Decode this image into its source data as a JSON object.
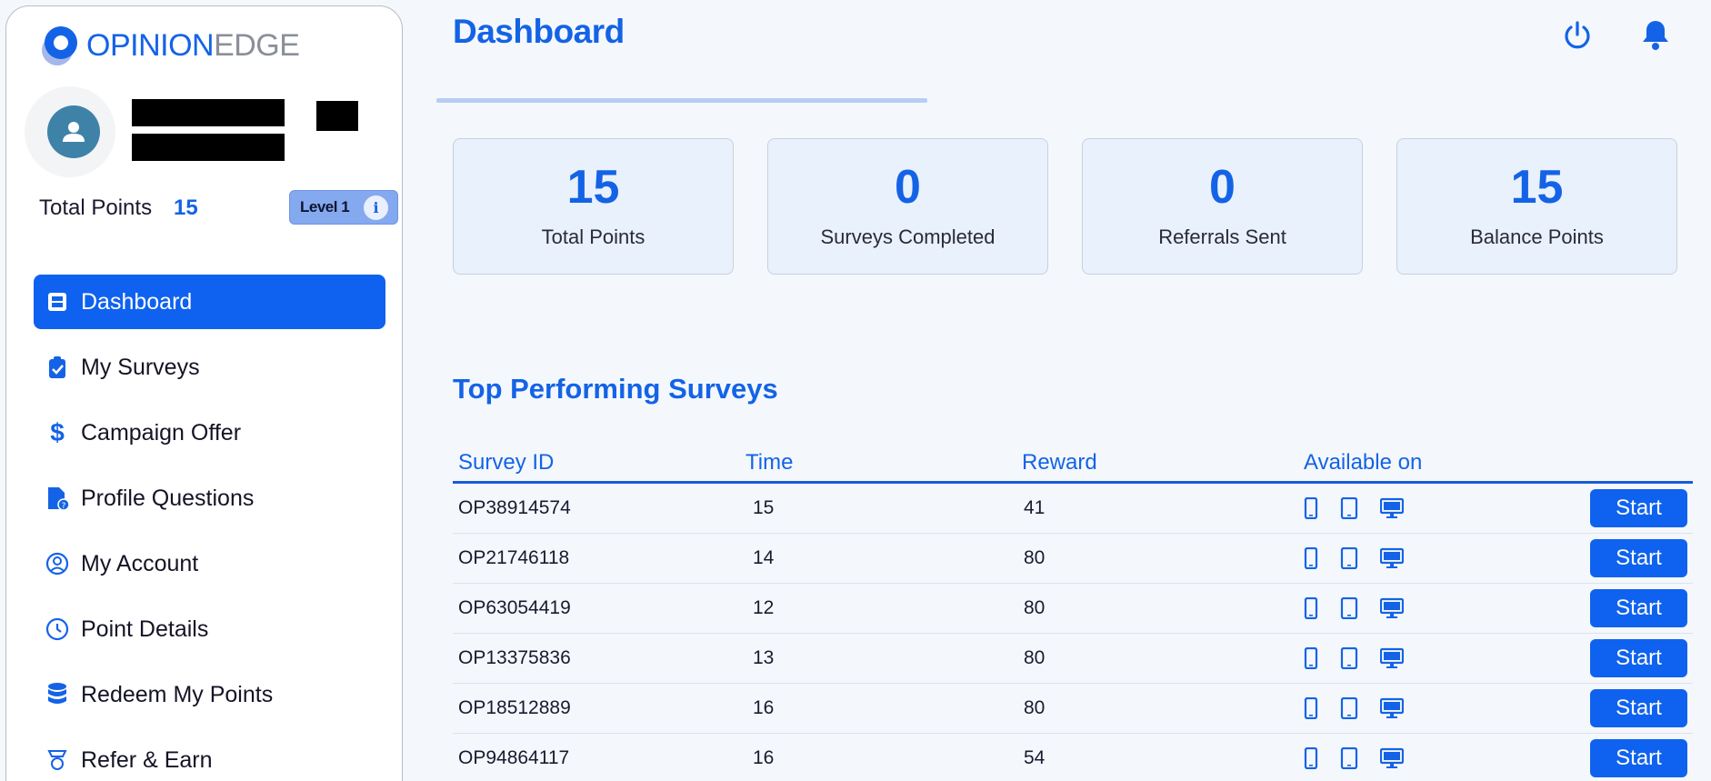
{
  "brand": {
    "part1": "OPINION",
    "part2": "EDGE"
  },
  "profile": {
    "total_points_label": "Total Points",
    "total_points_value": "15",
    "level_label": "Level 1",
    "info_glyph": "i"
  },
  "sidebar": {
    "items": [
      {
        "label": "Dashboard",
        "icon": "dashboard-icon",
        "active": true
      },
      {
        "label": "My Surveys",
        "icon": "clipboard-check-icon"
      },
      {
        "label": "Campaign Offer",
        "icon": "dollar-icon"
      },
      {
        "label": "Profile Questions",
        "icon": "file-question-icon"
      },
      {
        "label": "My Account",
        "icon": "user-circle-icon"
      },
      {
        "label": "Point Details",
        "icon": "clock-icon"
      },
      {
        "label": "Redeem My Points",
        "icon": "database-icon"
      },
      {
        "label": "Refer & Earn",
        "icon": "trophy-icon"
      }
    ]
  },
  "header": {
    "title": "Dashboard",
    "icons": [
      "power-icon",
      "bell-icon"
    ]
  },
  "stats": [
    {
      "value": "15",
      "label": "Total Points"
    },
    {
      "value": "0",
      "label": "Surveys Completed"
    },
    {
      "value": "0",
      "label": "Referrals Sent"
    },
    {
      "value": "15",
      "label": "Balance Points"
    }
  ],
  "surveys": {
    "title": "Top Performing Surveys",
    "columns": [
      "Survey ID",
      "Time",
      "Reward",
      "Available on"
    ],
    "start_label": "Start",
    "devices": [
      "mobile-icon",
      "tablet-icon",
      "desktop-icon"
    ],
    "rows": [
      {
        "id": "OP38914574",
        "time": "15",
        "reward": "41"
      },
      {
        "id": "OP21746118",
        "time": "14",
        "reward": "80"
      },
      {
        "id": "OP63054419",
        "time": "12",
        "reward": "80"
      },
      {
        "id": "OP13375836",
        "time": "13",
        "reward": "80"
      },
      {
        "id": "OP18512889",
        "time": "16",
        "reward": "80"
      },
      {
        "id": "OP94864117",
        "time": "16",
        "reward": "54"
      }
    ]
  },
  "colors": {
    "accent": "#1463e6",
    "active_nav": "#0f62ef",
    "card_bg": "#e9f1fd"
  }
}
